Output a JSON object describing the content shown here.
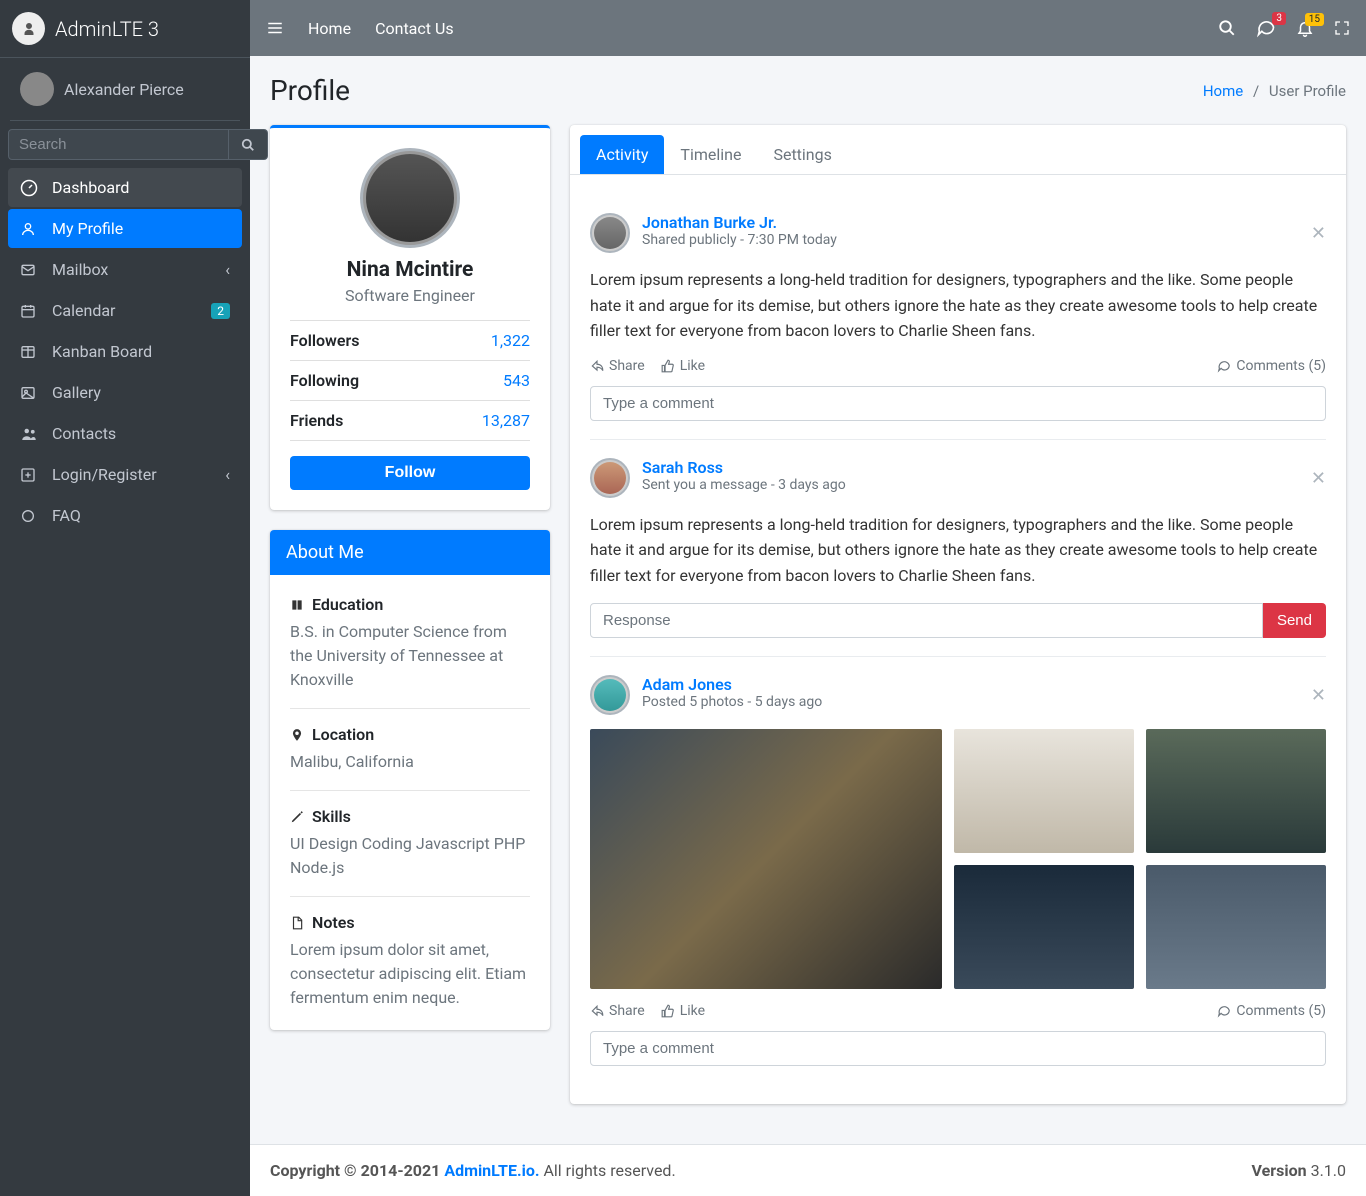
{
  "brand": "AdminLTE 3",
  "user": {
    "name": "Alexander Pierce"
  },
  "search": {
    "placeholder": "Search"
  },
  "nav": {
    "dashboard": "Dashboard",
    "myprofile": "My Profile",
    "mailbox": "Mailbox",
    "calendar": "Calendar",
    "calendar_badge": "2",
    "kanban": "Kanban Board",
    "gallery": "Gallery",
    "contacts": "Contacts",
    "login": "Login/Register",
    "faq": "FAQ"
  },
  "topnav": {
    "home": "Home",
    "contact": "Contact Us",
    "chat_badge": "3",
    "bell_badge": "15"
  },
  "header": {
    "title": "Profile",
    "crumb_home": "Home",
    "crumb_sep": "/",
    "crumb_current": "User Profile"
  },
  "profile": {
    "name": "Nina Mcintire",
    "role": "Software Engineer",
    "followers_label": "Followers",
    "followers": "1,322",
    "following_label": "Following",
    "following": "543",
    "friends_label": "Friends",
    "friends": "13,287",
    "follow_btn": "Follow"
  },
  "about": {
    "title": "About Me",
    "education_label": "Education",
    "education": "B.S. in Computer Science from the University of Tennessee at Knoxville",
    "location_label": "Location",
    "location": "Malibu, California",
    "skills_label": "Skills",
    "skills": "UI Design Coding Javascript PHP Node.js",
    "notes_label": "Notes",
    "notes": "Lorem ipsum dolor sit amet, consectetur adipiscing elit. Etiam fermentum enim neque."
  },
  "tabs": {
    "activity": "Activity",
    "timeline": "Timeline",
    "settings": "Settings"
  },
  "posts": {
    "p1_user": "Jonathan Burke Jr.",
    "p1_meta": "Shared publicly - 7:30 PM today",
    "p1_body": "Lorem ipsum represents a long-held tradition for designers, typographers and the like. Some people hate it and argue for its demise, but others ignore the hate as they create awesome tools to help create filler text for everyone from bacon lovers to Charlie Sheen fans.",
    "p2_user": "Sarah Ross",
    "p2_meta": "Sent you a message - 3 days ago",
    "p2_body": "Lorem ipsum represents a long-held tradition for designers, typographers and the like. Some people hate it and argue for its demise, but others ignore the hate as they create awesome tools to help create filler text for everyone from bacon lovers to Charlie Sheen fans.",
    "p3_user": "Adam Jones",
    "p3_meta": "Posted 5 photos - 5 days ago",
    "share": "Share",
    "like": "Like",
    "comments": "Comments (5)",
    "comment_placeholder": "Type a comment",
    "response_placeholder": "Response",
    "send": "Send"
  },
  "footer": {
    "copyright": "Copyright © 2014-2021 ",
    "link": "AdminLTE.io.",
    "rights": " All rights reserved.",
    "version_label": "Version",
    "version": " 3.1.0"
  }
}
